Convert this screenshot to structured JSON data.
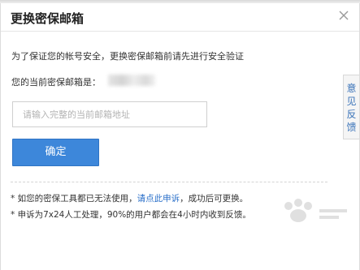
{
  "dialog": {
    "title": "更换密保邮箱",
    "close_icon": "close-icon"
  },
  "main": {
    "intro": "为了保证您的帐号安全，更换密保邮箱前请先进行安全验证",
    "current_email_label": "您的当前密保邮箱是：",
    "email_input_placeholder": "请输入完整的当前邮箱地址",
    "confirm_label": "确定"
  },
  "notes": {
    "line1_prefix": "* 如您的密保工具都已无法使用，",
    "line1_link": "请点此申诉",
    "line1_suffix": "，成功后可更换。",
    "line2": "* 申诉为7x24人工处理，90%的用户都会在4小时内收到反馈。"
  },
  "side": {
    "feedback_label": "意见反馈"
  },
  "colors": {
    "accent": "#3d87da",
    "link": "#2a6fc9",
    "feedback_text": "#3a73b9"
  }
}
